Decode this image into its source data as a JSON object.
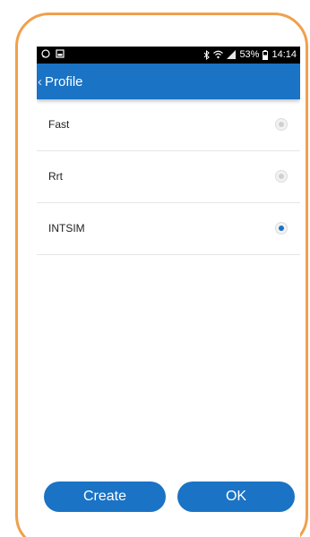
{
  "status_bar": {
    "battery": "53%",
    "time": "14:14"
  },
  "header": {
    "back_icon": "‹",
    "title": "Profile"
  },
  "profiles": [
    {
      "label": "Fast",
      "selected": false
    },
    {
      "label": "Rrt",
      "selected": false
    },
    {
      "label": "INTSIM",
      "selected": true
    }
  ],
  "buttons": {
    "create_label": "Create",
    "ok_label": "OK"
  },
  "colors": {
    "accent": "#1a73c4",
    "frame_border": "#f0a04b"
  }
}
